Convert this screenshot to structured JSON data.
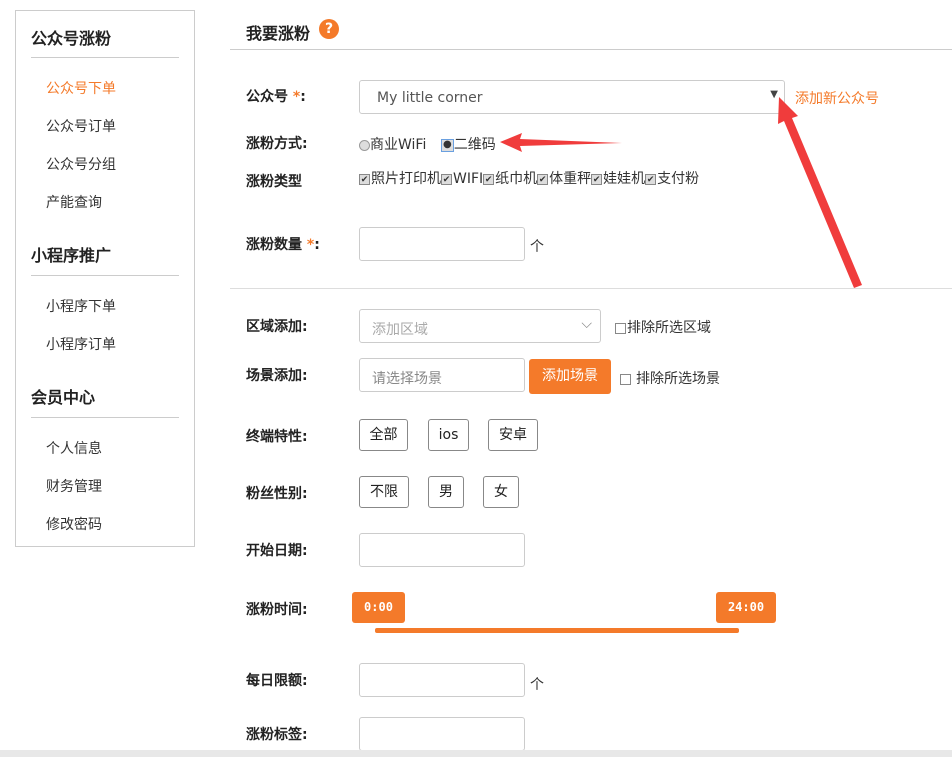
{
  "sidebar": {
    "sections": [
      {
        "title": "公众号涨粉",
        "items": [
          "公众号下单",
          "公众号订单",
          "公众号分组",
          "产能查询"
        ]
      },
      {
        "title": "小程序推广",
        "items": [
          "小程序下单",
          "小程序订单"
        ]
      },
      {
        "title": "会员中心",
        "items": [
          "个人信息",
          "财务管理",
          "修改密码"
        ]
      }
    ]
  },
  "header": {
    "title": "我要涨粉",
    "help": "?"
  },
  "form": {
    "account_label": "公众号",
    "star": "*",
    "colon": ":",
    "account_value": "My little corner",
    "add_account": "添加新公众号",
    "method_label": "涨粉方式:",
    "method_options": [
      "商业WiFi",
      "二维码"
    ],
    "type_label": "涨粉类型",
    "types": [
      "照片打印机",
      "WIFI",
      "纸巾机",
      "体重秤",
      "娃娃机",
      "支付粉"
    ],
    "qty_label": "涨粉数量",
    "unit": "个",
    "region_label": "区域添加:",
    "region_placeholder": "添加区域",
    "exclude_region": "排除所选区域",
    "scene_label": "场景添加:",
    "scene_placeholder": "请选择场景",
    "add_scene": "添加场景",
    "exclude_scene": "排除所选场景",
    "terminal_label": "终端特性:",
    "terminals": [
      "全部",
      "ios",
      "安卓"
    ],
    "gender_label": "粉丝性别:",
    "genders": [
      "不限",
      "男",
      "女"
    ],
    "start_label": "开始日期:",
    "time_label": "涨粉时间:",
    "time_start": "0:00",
    "time_end": "24:00",
    "daily_label": "每日限额:",
    "tag_label": "涨粉标签:"
  },
  "colors": {
    "accent": "#f47a2a",
    "arrow": "#f03c3c"
  }
}
